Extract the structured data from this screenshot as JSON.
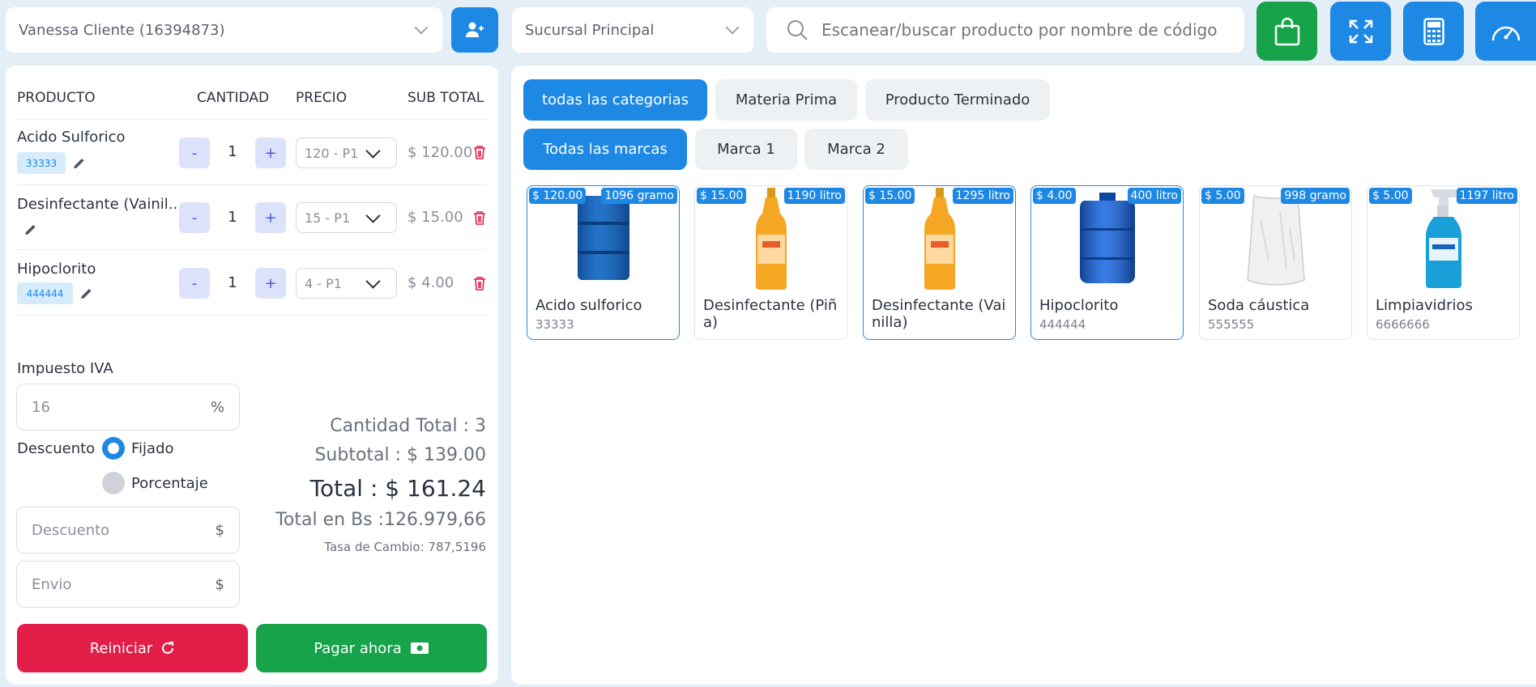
{
  "customer_select": {
    "value": "Vanessa Cliente (16394873)"
  },
  "branch_select": {
    "value": "Sucursal Principal"
  },
  "search": {
    "placeholder": "Escanear/buscar producto por nombre de código"
  },
  "cart": {
    "headers": {
      "product": "PRODUCTO",
      "quantity": "CANTIDAD",
      "price": "PRECIO",
      "subtotal": "SUB TOTAL"
    },
    "rows": [
      {
        "name": "Acido Sulforico",
        "code": "33333",
        "qty": "1",
        "price": "120 - P1",
        "subtotal": "$ 120.00"
      },
      {
        "name": "Desinfectante (Vainil...",
        "code": "",
        "qty": "1",
        "price": "15 - P1",
        "subtotal": "$ 15.00"
      },
      {
        "name": "Hipoclorito",
        "code": "444444",
        "qty": "1",
        "price": "4 - P1",
        "subtotal": "$ 4.00"
      }
    ],
    "minus": "-",
    "plus": "+"
  },
  "tax": {
    "label": "Impuesto IVA",
    "value": "16",
    "suffix": "%"
  },
  "discount": {
    "label": "Descuento",
    "option_fixed": "Fijado",
    "option_percent": "Porcentaje",
    "selected": "Fijado",
    "placeholder": "Descuento",
    "suffix": "$"
  },
  "shipping": {
    "placeholder": "Envio",
    "suffix": "$"
  },
  "totals": {
    "quantity": "Cantidad Total : 3",
    "subtotal": "Subtotal : $ 139.00",
    "total": "Total : $ 161.24",
    "total_bs": "Total en Bs :126.979,66",
    "rate": "Tasa de Cambio: 787,5196"
  },
  "actions": {
    "reset": "Reiniciar",
    "pay": "Pagar ahora"
  },
  "categories": [
    "todas las categorias",
    "Materia Prima",
    "Producto Terminado"
  ],
  "brands": [
    "Todas las marcas",
    "Marca 1",
    "Marca 2"
  ],
  "products": [
    {
      "name": "Acido sulforico",
      "code": "33333",
      "price": "$ 120.00",
      "stock": "1096 gramo",
      "image": "barrel-drum-icon"
    },
    {
      "name": "Desinfectante (Piña)",
      "code": "",
      "price": "$ 15.00",
      "stock": "1190 litro",
      "image": "bottle-icon"
    },
    {
      "name": "Desinfectante (Vainilla)",
      "code": "",
      "price": "$ 15.00",
      "stock": "1295 litro",
      "image": "bottle-icon"
    },
    {
      "name": "Hipoclorito",
      "code": "444444",
      "price": "$ 4.00",
      "stock": "400 litro",
      "image": "plastic-barrel-icon"
    },
    {
      "name": "Soda cáustica",
      "code": "555555",
      "price": "$ 5.00",
      "stock": "998 gramo",
      "image": "sack-icon"
    },
    {
      "name": "Limpiavidrios",
      "code": "6666666",
      "price": "$ 5.00",
      "stock": "1197 litro",
      "image": "spray-bottle-icon"
    }
  ],
  "colors": {
    "primary": "#1e88e5",
    "success": "#16a34a",
    "danger": "#e11d48",
    "background": "#e3eef7"
  }
}
